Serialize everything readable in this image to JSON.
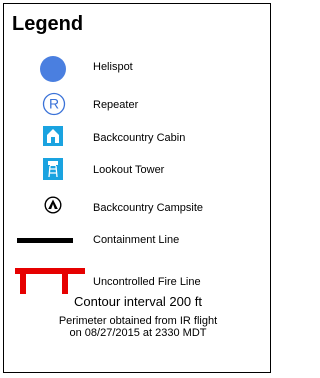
{
  "legend": {
    "title": "Legend",
    "items": [
      {
        "icon": "helispot-icon",
        "color": "#4a7fe0",
        "label": "Helispot"
      },
      {
        "icon": "repeater-icon",
        "color": "#3a72d8",
        "label": "Repeater"
      },
      {
        "icon": "backcountry-cabin-icon",
        "color": "#1aa3e0",
        "label": "Backcountry Cabin"
      },
      {
        "icon": "lookout-tower-icon",
        "color": "#1aa3e0",
        "label": "Lookout Tower"
      },
      {
        "icon": "backcountry-campsite-icon",
        "color": "#000000",
        "label": "Backcountry Campsite"
      },
      {
        "icon": "containment-line",
        "color": "#000000",
        "label": "Containment Line"
      },
      {
        "icon": "uncontrolled-fire-line",
        "color": "#e60000",
        "label": "Uncontrolled Fire Line"
      }
    ],
    "contour_note": "Contour interval 200 ft",
    "perimeter_note": [
      "Perimeter obtained from IR flight",
      "on 08/27/2015 at 2330 MDT"
    ]
  }
}
